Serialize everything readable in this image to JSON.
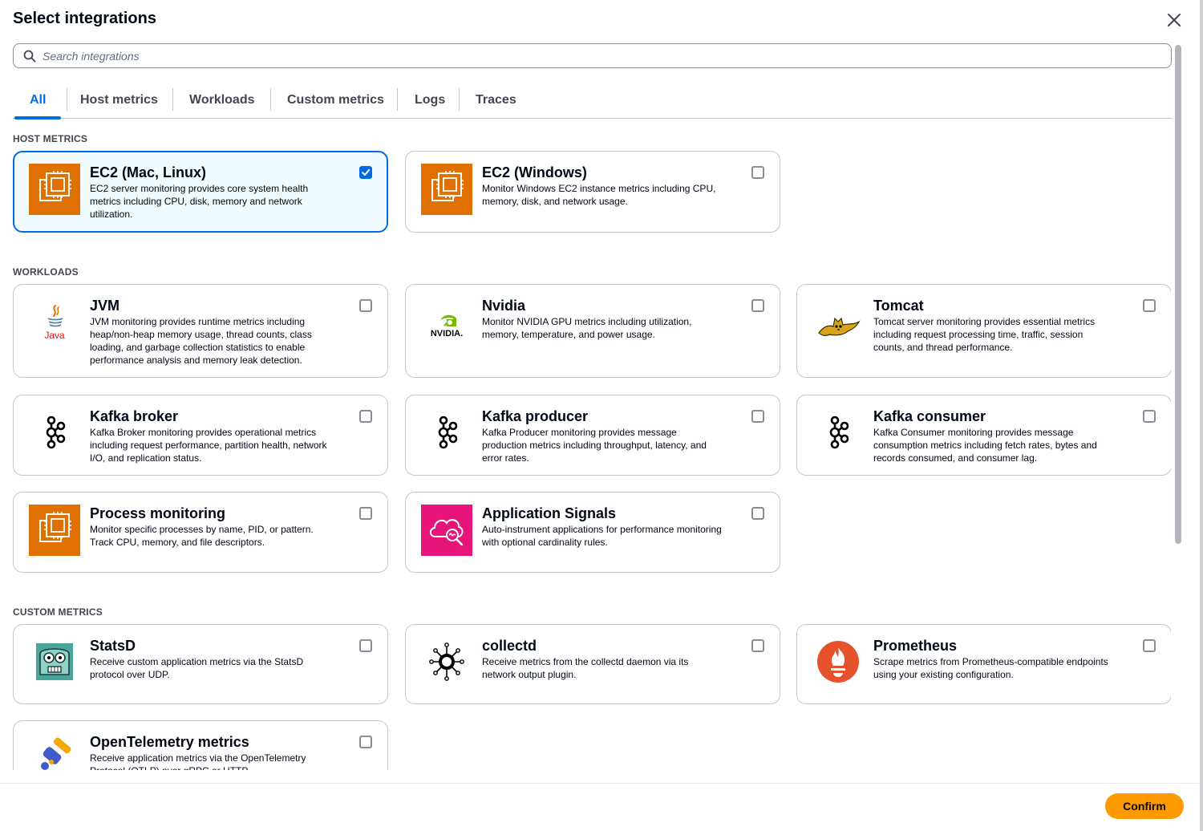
{
  "modal": {
    "title": "Select integrations",
    "close_label": "Close"
  },
  "search": {
    "placeholder": "Search integrations",
    "value": ""
  },
  "tabs": [
    {
      "label": "All",
      "active": true
    },
    {
      "label": "Host metrics",
      "active": false
    },
    {
      "label": "Workloads",
      "active": false
    },
    {
      "label": "Custom metrics",
      "active": false
    },
    {
      "label": "Logs",
      "active": false
    },
    {
      "label": "Traces",
      "active": false
    }
  ],
  "sections": {
    "host_metrics": {
      "label": "HOST METRICS",
      "cards": [
        {
          "title": "EC2 (Mac, Linux)",
          "description": "EC2 server monitoring provides core system health metrics including CPU, disk, memory and network utilization.",
          "icon": "ec2-chip-icon",
          "checked": true
        },
        {
          "title": "EC2 (Windows)",
          "description": "Monitor Windows EC2 instance metrics including CPU, memory, disk, and network usage.",
          "icon": "ec2-chip-icon",
          "checked": false
        }
      ]
    },
    "workloads": {
      "label": "WORKLOADS",
      "cards": [
        {
          "title": "JVM",
          "description": "JVM monitoring provides runtime metrics including heap/non-heap memory usage, thread counts, class loading, and garbage collection statistics to enable performance analysis and memory leak detection.",
          "icon": "java-logo-icon",
          "logo_text": "Java",
          "checked": false
        },
        {
          "title": "Nvidia",
          "description": "Monitor NVIDIA GPU metrics including utilization, memory, temperature, and power usage.",
          "icon": "nvidia-logo-icon",
          "logo_text": "NVIDIA.",
          "checked": false
        },
        {
          "title": "Tomcat",
          "description": "Tomcat server monitoring provides essential metrics including request processing time, traffic, session counts, and thread performance.",
          "icon": "tomcat-logo-icon",
          "checked": false
        },
        {
          "title": "Kafka broker",
          "description": "Kafka Broker monitoring provides operational metrics including request performance, partition health, network I/O, and replication status.",
          "icon": "kafka-logo-icon",
          "checked": false
        },
        {
          "title": "Kafka producer",
          "description": "Kafka Producer monitoring provides message production metrics including throughput, latency, and error rates.",
          "icon": "kafka-logo-icon",
          "checked": false
        },
        {
          "title": "Kafka consumer",
          "description": "Kafka Consumer monitoring provides message consumption metrics including fetch rates, bytes and records consumed, and consumer lag.",
          "icon": "kafka-logo-icon",
          "checked": false
        },
        {
          "title": "Process monitoring",
          "description": "Monitor specific processes by name, PID, or pattern. Track CPU, memory, and file descriptors.",
          "icon": "ec2-chip-icon",
          "checked": false
        },
        {
          "title": "Application Signals",
          "description": "Auto-instrument applications for performance monitoring with optional cardinality rules.",
          "icon": "application-signals-icon",
          "checked": false
        }
      ]
    },
    "custom_metrics": {
      "label": "CUSTOM METRICS",
      "cards": [
        {
          "title": "StatsD",
          "description": "Receive custom application metrics via the StatsD protocol over UDP.",
          "icon": "statsd-logo-icon",
          "checked": false
        },
        {
          "title": "collectd",
          "description": "Receive metrics from the collectd daemon via its network output plugin.",
          "icon": "collectd-logo-icon",
          "checked": false
        },
        {
          "title": "Prometheus",
          "description": "Scrape metrics from Prometheus-compatible endpoints using your existing configuration.",
          "icon": "prometheus-logo-icon",
          "checked": false
        },
        {
          "title": "OpenTelemetry metrics",
          "description": "Receive application metrics via the OpenTelemetry Protocol (OTLP) over gRPC or HTTP.",
          "icon": "opentelemetry-logo-icon",
          "checked": false
        }
      ]
    }
  },
  "footer": {
    "confirm_label": "Confirm"
  },
  "colors": {
    "accent": "#006ce0",
    "ec2_orange": "#e07000",
    "app_signals_pink": "#e7157b",
    "confirm_orange": "#ff9900",
    "prometheus_red": "#e6522c"
  }
}
